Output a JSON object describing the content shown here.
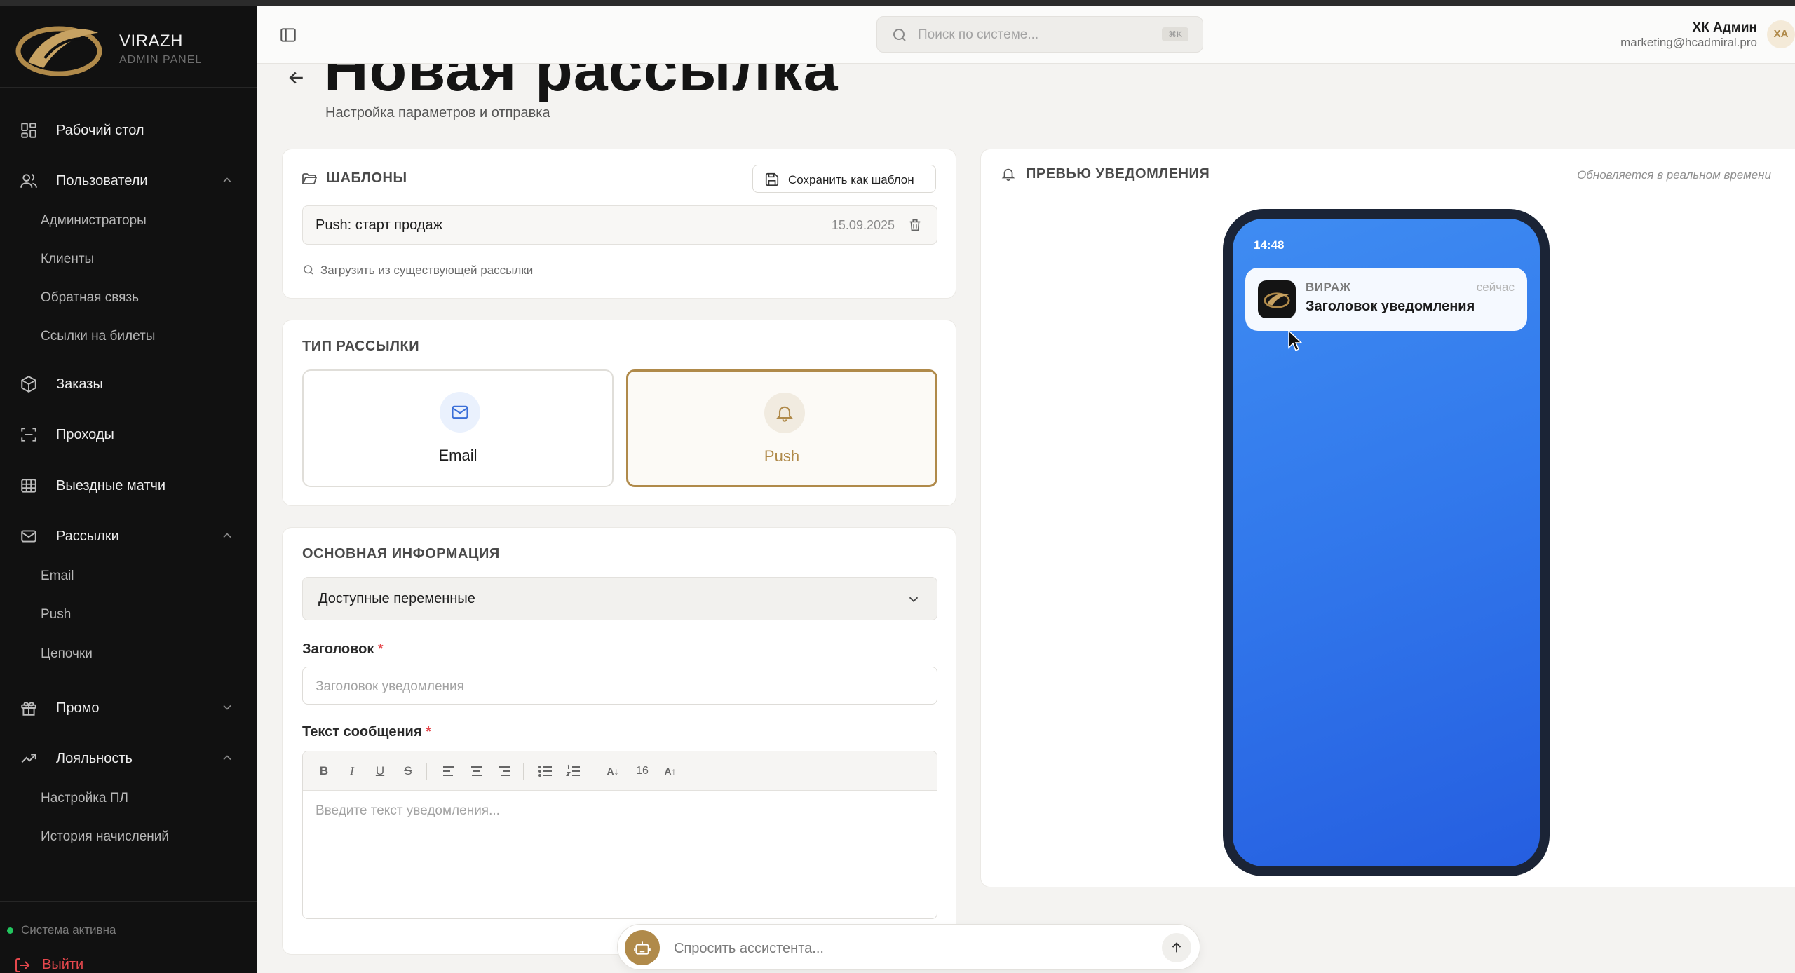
{
  "brand": {
    "name": "VIRAZH",
    "subtitle": "ADMIN PANEL"
  },
  "sidebar": {
    "items": [
      {
        "label": "Рабочий стол",
        "icon": "dashboard-icon"
      },
      {
        "label": "Пользователи",
        "icon": "users-icon",
        "expanded": true,
        "children": [
          "Администраторы",
          "Клиенты",
          "Обратная связь",
          "Ссылки на билеты"
        ]
      },
      {
        "label": "Заказы",
        "icon": "box-icon"
      },
      {
        "label": "Проходы",
        "icon": "scan-icon"
      },
      {
        "label": "Выездные матчи",
        "icon": "globe-icon"
      },
      {
        "label": "Рассылки",
        "icon": "mail-icon",
        "expanded": true,
        "children": [
          "Email",
          "Push",
          "Цепочки"
        ]
      },
      {
        "label": "Промо",
        "icon": "gift-icon",
        "expanded": false
      },
      {
        "label": "Лояльность",
        "icon": "trending-up-icon",
        "expanded": true,
        "children": [
          "Настройка ПЛ",
          "История начислений"
        ]
      }
    ],
    "status": "Система активна",
    "logout": "Выйти"
  },
  "topbar": {
    "search_placeholder": "Поиск по системе...",
    "shortcut": "⌘K",
    "user_name": "ХК Админ",
    "user_email": "marketing@hcadmiral.pro",
    "avatar_initials": "ХА"
  },
  "page": {
    "title": "Новая рассылка",
    "subtitle": "Настройка параметров и отправка"
  },
  "templates": {
    "title": "ШАБЛОНЫ",
    "save_button": "Сохранить как шаблон",
    "items": [
      {
        "name": "Push: старт продаж",
        "date": "15.09.2025"
      }
    ],
    "load_link": "Загрузить из существующей рассылки"
  },
  "mailing_type": {
    "title": "ТИП РАССЫЛКИ",
    "options": [
      {
        "label": "Email",
        "selected": false
      },
      {
        "label": "Push",
        "selected": true
      }
    ]
  },
  "basic_info": {
    "title": "ОСНОВНАЯ ИНФОРМАЦИЯ",
    "variables_select": "Доступные переменные",
    "heading_label": "Заголовок",
    "heading_placeholder": "Заголовок уведомления",
    "message_label": "Текст сообщения",
    "message_placeholder": "Введите текст уведомления...",
    "required_mark": "*",
    "font_size": "16"
  },
  "preview": {
    "title": "ПРЕВЬЮ УВЕДОМЛЕНИЯ",
    "hint": "Обновляется в реальном времени",
    "phone_time": "14:48",
    "notification": {
      "app": "ВИРАЖ",
      "when": "сейчас",
      "title": "Заголовок уведомления"
    }
  },
  "assistant": {
    "placeholder": "Спросить ассистента..."
  },
  "colors": {
    "accent": "#b08a4a",
    "sidebar_bg": "#111111",
    "danger": "#e5484d",
    "phone_blue": "#3279ec"
  }
}
